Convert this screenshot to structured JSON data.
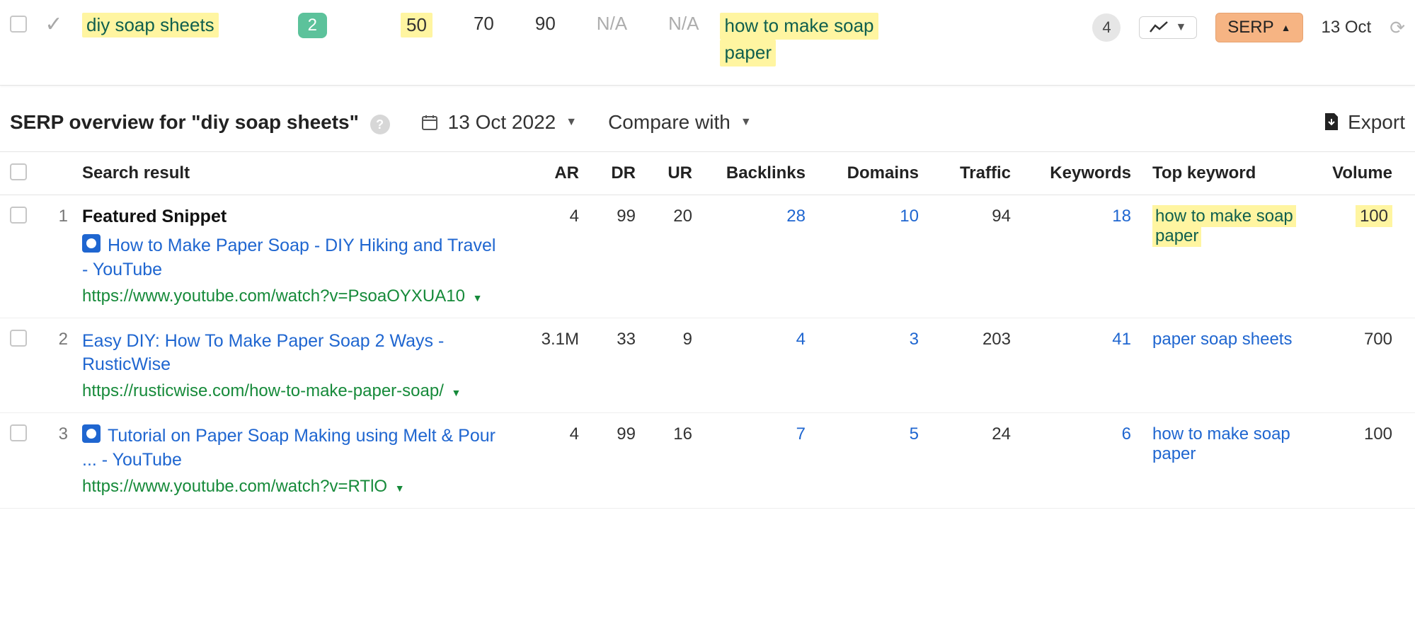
{
  "topRow": {
    "keyword": "diy soap sheets",
    "position": "2",
    "cols": [
      "50",
      "70",
      "90",
      "N/A",
      "N/A"
    ],
    "topKeywordLine1": "how to make soap",
    "topKeywordLine2": "paper",
    "circle": "4",
    "serpLabel": "SERP",
    "date": "13 Oct"
  },
  "overview": {
    "title": "SERP overview for \"diy soap sheets\"",
    "date": "13 Oct 2022",
    "compare": "Compare with",
    "export": "Export"
  },
  "headers": {
    "sr": "Search result",
    "ar": "AR",
    "dr": "DR",
    "ur": "UR",
    "bl": "Backlinks",
    "dom": "Domains",
    "tr": "Traffic",
    "kw": "Keywords",
    "top": "Top keyword",
    "vol": "Volume"
  },
  "rows": [
    {
      "idx": "1",
      "featured": "Featured Snippet",
      "hasIcon": true,
      "title": "How to Make Paper Soap - DIY Hiking and Travel - YouTube",
      "url": "https://www.youtube.com/watch?v=PsoaOYXUA10",
      "ar": "4",
      "dr": "99",
      "ur": "20",
      "bl": "28",
      "dom": "10",
      "tr": "94",
      "kw": "18",
      "topKeywordL1": "how to make soap",
      "topKeywordL2": "paper",
      "topHighlighted": true,
      "vol": "100",
      "volHighlighted": true
    },
    {
      "idx": "2",
      "featured": "",
      "hasIcon": false,
      "title": "Easy DIY: How To Make Paper Soap 2 Ways - RusticWise",
      "url": "https://rusticwise.com/how-to-make-paper-soap/",
      "ar": "3.1M",
      "dr": "33",
      "ur": "9",
      "bl": "4",
      "dom": "3",
      "tr": "203",
      "kw": "41",
      "topKeywordL1": "paper soap sheets",
      "topKeywordL2": "",
      "topHighlighted": false,
      "vol": "700",
      "volHighlighted": false
    },
    {
      "idx": "3",
      "featured": "",
      "hasIcon": true,
      "title": "Tutorial on Paper Soap Making using Melt & Pour ... - YouTube",
      "url": "https://www.youtube.com/watch?v=RTlO",
      "ar": "4",
      "dr": "99",
      "ur": "16",
      "bl": "7",
      "dom": "5",
      "tr": "24",
      "kw": "6",
      "topKeywordL1": "how to make soap",
      "topKeywordL2": "paper",
      "topHighlighted": false,
      "vol": "100",
      "volHighlighted": false
    }
  ]
}
